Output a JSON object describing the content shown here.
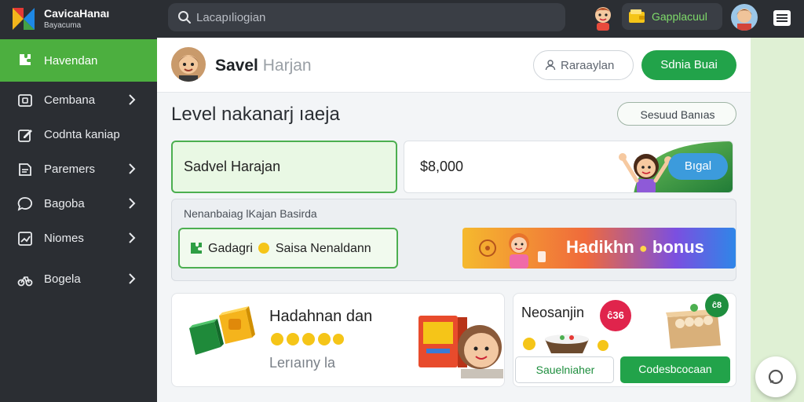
{
  "header": {
    "brand_title": "CavicaHanaı",
    "brand_sub": "Bayacuma",
    "search_placeholder": "Lacapıliogian",
    "wallet_label": "Gapplacuul"
  },
  "sidebar": {
    "items": [
      {
        "label": "Havendan",
        "icon": "puzzle-icon",
        "active": true
      },
      {
        "label": "Cembana",
        "icon": "wallet-icon",
        "chevron": true
      },
      {
        "label": "Codnta kaniap",
        "icon": "edit-icon",
        "chevron": false
      },
      {
        "label": "Paremers",
        "icon": "document-icon",
        "chevron": true
      },
      {
        "label": "Bagoba",
        "icon": "chat-icon",
        "chevron": true
      },
      {
        "label": "Niomes",
        "icon": "chart-icon",
        "chevron": true
      },
      {
        "label": "Bogela",
        "icon": "bike-icon",
        "chevron": true
      }
    ]
  },
  "profile": {
    "name": "Savel",
    "name_sub": "Harjan",
    "outline_button": "Raraaylan",
    "primary_button": "Sdnia Buai"
  },
  "section": {
    "title": "Level nakanarj ıaeja",
    "action_button": "Sesuud Banıas"
  },
  "form": {
    "name_value": "Sadvel Harajan",
    "amount_value": "$8,000",
    "amount_button": "Bıgal"
  },
  "info": {
    "label": "Nenanbaiag lKajan Basirda",
    "chip_label": "Gadagri",
    "chip_label_2": "Saisa Nenaldann",
    "banner_label": "Hadikhn",
    "banner_label_2": "bonus"
  },
  "card_a": {
    "title": "Hadahnan dan",
    "subtitle": "Lerıaıny la"
  },
  "card_b": {
    "title": "Neosanjin",
    "badge": "ĉ36",
    "badge_2": "ĉ8",
    "button_secondary": "Sauelniaher",
    "button_primary": "Codesbcocaan"
  },
  "colors": {
    "accent_green": "#22a34a",
    "sidebar_bg": "#2b2e33",
    "sidebar_active": "#4caf3f",
    "banner_blue": "#2f86e8"
  }
}
